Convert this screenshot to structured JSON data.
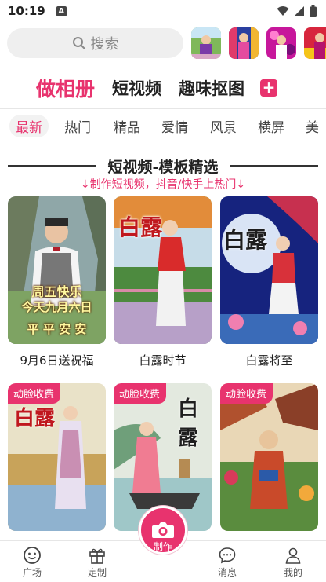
{
  "status": {
    "time": "10:19",
    "notification_letter": "A"
  },
  "search": {
    "placeholder": "搜索"
  },
  "top_tabs": [
    {
      "label": "做相册",
      "active": true
    },
    {
      "label": "短视频",
      "active": false
    },
    {
      "label": "趣味抠图",
      "active": false
    }
  ],
  "add_button": "+",
  "categories": [
    {
      "label": "最新",
      "active": true
    },
    {
      "label": "热门",
      "active": false
    },
    {
      "label": "精品",
      "active": false
    },
    {
      "label": "爱情",
      "active": false
    },
    {
      "label": "风景",
      "active": false
    },
    {
      "label": "横屏",
      "active": false
    },
    {
      "label": "美",
      "active": false
    }
  ],
  "section": {
    "title": "短视频-模板精选",
    "subtitle": "↓制作短视频，抖音/快手上热门↓"
  },
  "templates": [
    {
      "label": "9月6日送祝福",
      "badge": "",
      "overlay": [
        "周五快乐",
        "今天九月六日",
        "平 平 安 安"
      ]
    },
    {
      "label": "白露时节",
      "badge": "",
      "overlay": [
        "白露"
      ]
    },
    {
      "label": "白露将至",
      "badge": "",
      "overlay": [
        "白露"
      ]
    },
    {
      "label": "",
      "badge": "动脸收费",
      "overlay": [
        "白露"
      ]
    },
    {
      "label": "",
      "badge": "动脸收费",
      "overlay": [
        "白露"
      ]
    },
    {
      "label": "",
      "badge": "动脸收费",
      "overlay": []
    }
  ],
  "bottom_nav": [
    {
      "label": "广场",
      "icon": "plaza-icon"
    },
    {
      "label": "定制",
      "icon": "gift-icon"
    },
    {
      "label": "制作",
      "icon": "camera-icon"
    },
    {
      "label": "消息",
      "icon": "message-icon"
    },
    {
      "label": "我的",
      "icon": "profile-icon"
    }
  ],
  "colors": {
    "accent": "#e8336e"
  }
}
